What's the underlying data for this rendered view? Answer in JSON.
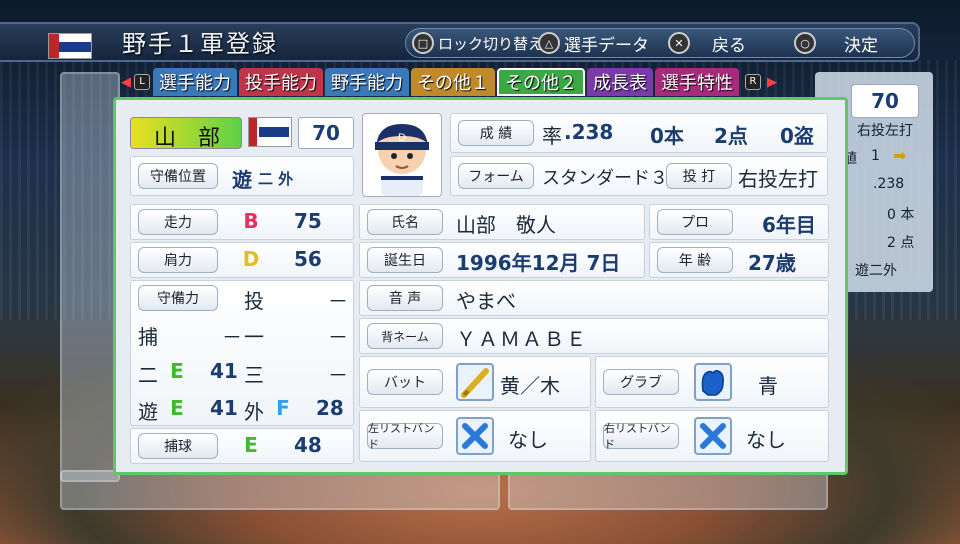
{
  "header": {
    "title": "野手１軍登録",
    "hints": [
      {
        "sym": "□",
        "label": "ロック切り替え"
      },
      {
        "sym": "△",
        "label": "選手データ"
      },
      {
        "sym": "✕",
        "label": "戻る"
      },
      {
        "sym": "○",
        "label": "決定"
      }
    ]
  },
  "tabs": {
    "left_key": "L",
    "right_key": "R",
    "items": [
      {
        "label": "選手能力",
        "color": "#3a78b8"
      },
      {
        "label": "投手能力",
        "color": "#c0344a"
      },
      {
        "label": "野手能力",
        "color": "#3a78b8"
      },
      {
        "label": "その他１",
        "color": "#c08a2a"
      },
      {
        "label": "その他２",
        "color": "#3aa845",
        "active": true
      },
      {
        "label": "成長表",
        "color": "#7a3aa8"
      },
      {
        "label": "選手特性",
        "color": "#a82a7a"
      }
    ]
  },
  "player": {
    "name": "山　部",
    "number": "70",
    "position_main": "遊",
    "position_sub": "二 外",
    "position_label": "守備位置"
  },
  "stats_summary": {
    "label": "成 績",
    "avg_label": "率",
    "avg": ".238",
    "hr": "0本",
    "rbi": "2点",
    "sb": "0盗"
  },
  "form": {
    "label": "フォーム",
    "value": "スタンダード３",
    "throw_bat_label": "投 打",
    "throw_bat": "右投左打"
  },
  "abilities": {
    "speed": {
      "label": "走力",
      "rank": "B",
      "value": "75"
    },
    "arm": {
      "label": "肩力",
      "rank": "D",
      "value": "56"
    },
    "defense_label": "守備力",
    "positions": [
      {
        "pos": "投",
        "rank": "",
        "value": "－"
      },
      {
        "pos": "捕",
        "rank": "",
        "value": "－"
      },
      {
        "pos": "一",
        "rank": "",
        "value": "－"
      },
      {
        "pos": "二",
        "rank": "E",
        "value": "41"
      },
      {
        "pos": "三",
        "rank": "",
        "value": "－"
      },
      {
        "pos": "遊",
        "rank": "E",
        "value": "41"
      },
      {
        "pos": "外",
        "rank": "F",
        "value": "28"
      }
    ],
    "catch": {
      "label": "捕球",
      "rank": "E",
      "value": "48"
    }
  },
  "profile": {
    "name_label": "氏名",
    "full_name": "山部　敬人",
    "pro_label": "プロ",
    "pro_years": "6年目",
    "birth_label": "誕生日",
    "birthday": "1996年12月 7日",
    "age_label": "年 齢",
    "age": "27歳",
    "voice_label": "音 声",
    "voice": "やまべ",
    "back_name_label": "背ネーム",
    "back_name": "ＹＡＭＡＢＥ"
  },
  "equipment": {
    "bat_label": "バット",
    "bat": "黄／木",
    "glove_label": "グラブ",
    "glove": "青",
    "lwrist_label": "左リストバンド",
    "lwrist": "なし",
    "rwrist_label": "右リストバンド",
    "rwrist": "なし"
  },
  "side_panel": {
    "number": "70",
    "throw_bat": "右投左打",
    "line1_label": "値",
    "line1_val": "1",
    "avg": ".238",
    "hr": "0 本",
    "rbi": "2 点",
    "pos": "遊二外"
  },
  "colors": {
    "rank_B": "#e83060",
    "rank_D": "#e0c020",
    "rank_E": "#40b830",
    "rank_F": "#30a0e8",
    "accent": "#5fc864"
  }
}
